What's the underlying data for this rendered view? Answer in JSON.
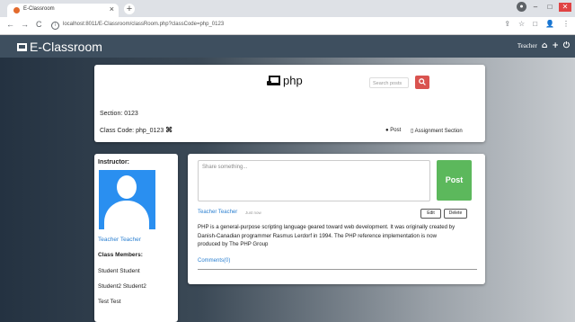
{
  "browser": {
    "tab_title": "E-Classroom",
    "tab_close": "×",
    "new_tab": "+",
    "url": "localhost:8011/E-Classroom/classRoom.php?classCode=php_0123",
    "nav_back": "←",
    "nav_forward": "→",
    "nav_reload": "C",
    "info": "i",
    "right_icons": [
      "⇪",
      "☆",
      "□",
      "👤",
      "⋮"
    ],
    "window_controls": {
      "minimize": "–",
      "maximize": "□",
      "close": "✕"
    }
  },
  "navbar": {
    "brand": "E-Classroom",
    "user": "Teacher",
    "home_icon": "⌂",
    "add_icon": "+",
    "logout_icon": "⏻"
  },
  "class": {
    "subject": "php",
    "search_placeholder": "Search posts",
    "search_icon": "search-icon",
    "section_text": "Section: 0123",
    "classcode_text": "Class Code: php_0123",
    "qr_glyph": "⌘",
    "post_link": "Post",
    "assignment_link": "Assignment Section"
  },
  "people": {
    "instructor_label": "Instructor:",
    "instructor_name": "Teacher Teacher",
    "members_label": "Class Members:",
    "members": [
      "Student Student",
      "Student2 Student2",
      "Test Test"
    ]
  },
  "feed": {
    "share_placeholder": "Share something...",
    "post_button": "Post",
    "post": {
      "author": "Teacher Teacher",
      "time": "Just now",
      "edit_label": "Edit",
      "delete_label": "Delete",
      "body": "PHP is a general-purpose scripting language geared toward web development. It was originally created by Danish-Canadian programmer Rasmus Lerdorf in 1994. The PHP reference implementation is now produced by The PHP Group",
      "comments_label": "Comments(0)"
    }
  },
  "colors": {
    "navbar": "#3e4f5f",
    "accent_link": "#2a7fd0",
    "post_button": "#5cb85c",
    "search_button": "#d9534f",
    "avatar_bg": "#2a8ff0"
  }
}
